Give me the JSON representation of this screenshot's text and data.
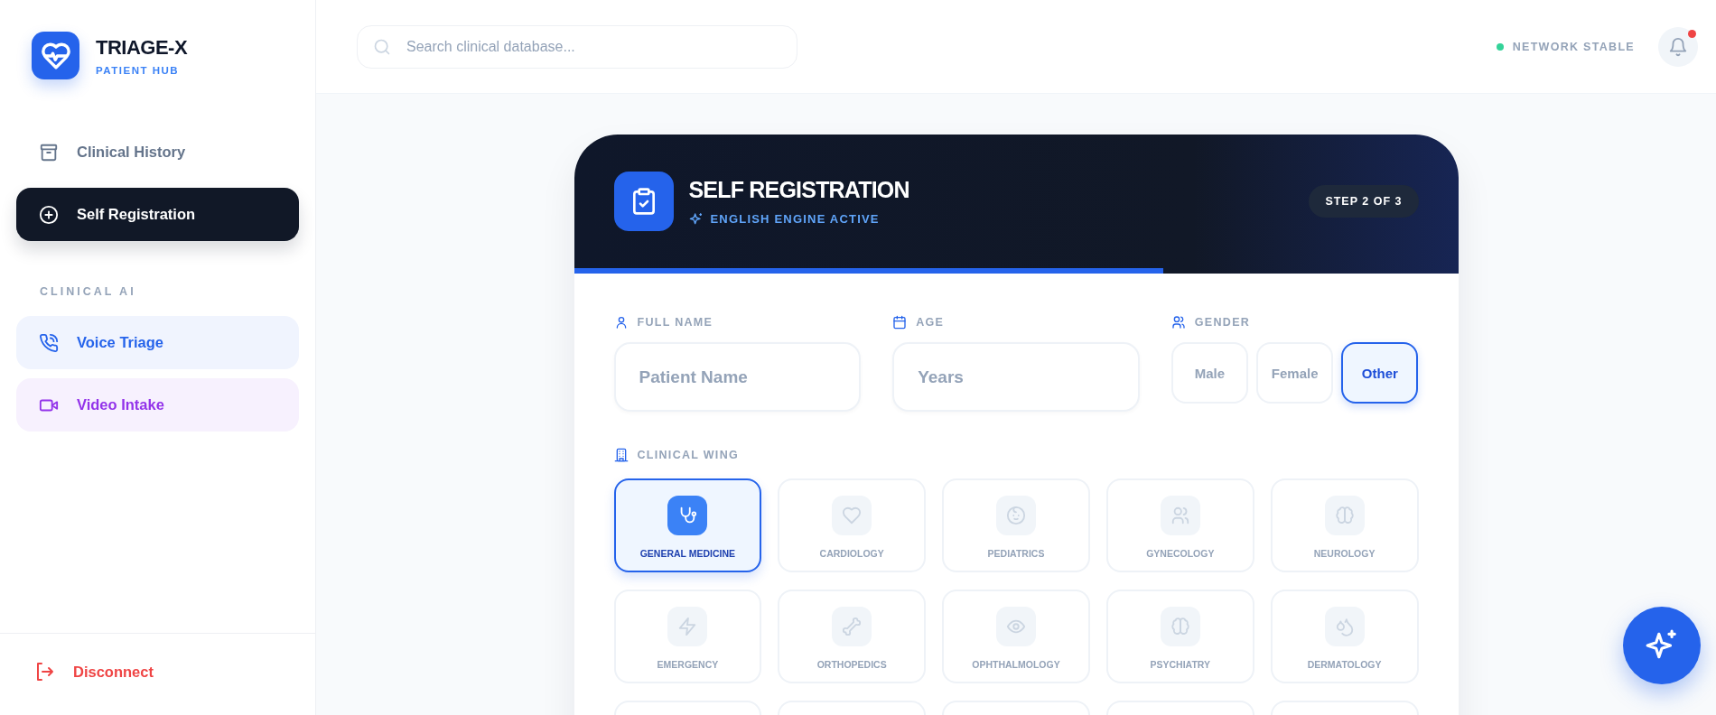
{
  "brand": {
    "title": "TRIAGE-X",
    "subtitle": "PATIENT HUB"
  },
  "nav": [
    {
      "label": "Clinical History",
      "selected": false
    },
    {
      "label": "Self Registration",
      "selected": true
    }
  ],
  "ai_section": {
    "heading": "CLINICAL AI",
    "items": [
      {
        "label": "Voice Triage",
        "color": "#2563eb"
      },
      {
        "label": "Video Intake",
        "color": "#9333ea"
      }
    ]
  },
  "logout": {
    "label": "Disconnect"
  },
  "search": {
    "placeholder": "Search clinical database..."
  },
  "status": {
    "label": "NETWORK STABLE",
    "online": true
  },
  "notifications": {
    "unread": true
  },
  "form": {
    "title": "SELF REGISTRATION",
    "engine": "ENGLISH ENGINE ACTIVE",
    "step": "STEP 2 OF 3",
    "progress": {
      "level": 0.667
    },
    "fields": [
      {
        "label": "FULL NAME",
        "placeholder": "Patient Name"
      },
      {
        "label": "AGE",
        "placeholder": "Years"
      }
    ],
    "gender": {
      "label": "GENDER",
      "options": [
        {
          "label": "Male",
          "selected": false
        },
        {
          "label": "Female",
          "selected": false
        },
        {
          "label": "Other",
          "selected": true
        }
      ]
    },
    "wing": {
      "label": "CLINICAL WING",
      "options": [
        {
          "label": "GENERAL MEDICINE",
          "selected": true
        },
        {
          "label": "CARDIOLOGY",
          "selected": false
        },
        {
          "label": "PEDIATRICS",
          "selected": false
        },
        {
          "label": "GYNECOLOGY",
          "selected": false
        },
        {
          "label": "NEUROLOGY",
          "selected": false
        },
        {
          "label": "EMERGENCY",
          "selected": false
        },
        {
          "label": "ORTHOPEDICS",
          "selected": false
        },
        {
          "label": "OPHTHALMOLOGY",
          "selected": false
        },
        {
          "label": "PSYCHIATRY",
          "selected": false
        },
        {
          "label": "DERMATOLOGY",
          "selected": false
        }
      ]
    }
  }
}
